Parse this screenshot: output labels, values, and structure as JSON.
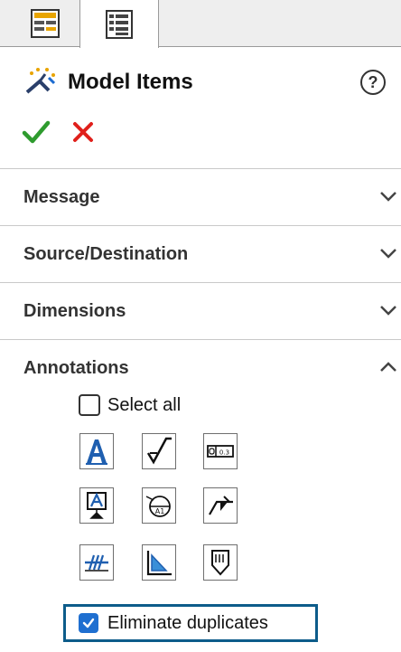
{
  "tabs": [
    {
      "icon": "property-manager-icon"
    },
    {
      "icon": "feature-tree-icon"
    }
  ],
  "header": {
    "title": "Model Items",
    "logo_icon": "model-items-icon",
    "help_icon": "help-icon"
  },
  "actions": {
    "ok_icon": "check-icon",
    "cancel_icon": "close-icon",
    "ok_color": "#2e9b2e",
    "cancel_color": "#e0201b"
  },
  "sections": {
    "message": {
      "label": "Message",
      "state": "collapsed"
    },
    "source": {
      "label": "Source/Destination",
      "state": "collapsed"
    },
    "dimensions": {
      "label": "Dimensions",
      "state": "collapsed"
    },
    "annotations": {
      "label": "Annotations",
      "state": "expanded"
    }
  },
  "annotations": {
    "select_all_label": "Select all",
    "select_all_checked": false,
    "buttons": [
      {
        "icon": "note-icon"
      },
      {
        "icon": "surface-finish-icon"
      },
      {
        "icon": "geometric-tolerance-icon"
      },
      {
        "icon": "datum-feature-icon"
      },
      {
        "icon": "datum-target-icon"
      },
      {
        "icon": "weld-symbol-icon"
      },
      {
        "icon": "cosmetic-thread-icon"
      },
      {
        "icon": "hole-table-icon"
      },
      {
        "icon": "caterpillar-icon"
      }
    ],
    "eliminate_duplicates_label": "Eliminate duplicates",
    "eliminate_duplicates_checked": true,
    "highlight_color": "#0d5c8a"
  }
}
